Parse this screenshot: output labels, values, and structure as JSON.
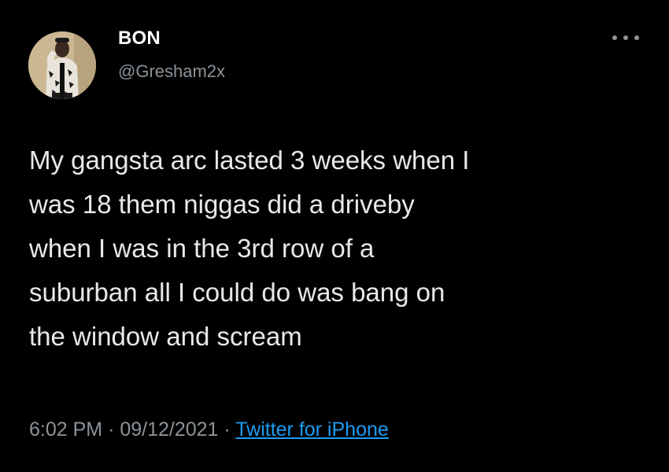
{
  "author": {
    "display_name": "BON",
    "handle": "@Gresham2x"
  },
  "tweet": {
    "lines": [
      "My gangsta arc lasted 3 weeks when I",
      "was 18 them niggas did a driveby",
      "when I was in the 3rd row of a",
      "suburban all I could do was bang on",
      "the window and scream"
    ],
    "time": "6:02 PM",
    "date": "09/12/2021",
    "separator": "·",
    "source": "Twitter for iPhone"
  },
  "icons": {
    "more": "more-options-icon",
    "avatar": "profile-avatar"
  },
  "colors": {
    "background": "#000000",
    "text": "#e7e9ea",
    "secondary": "#8b9399",
    "link": "#1d9bf0"
  }
}
